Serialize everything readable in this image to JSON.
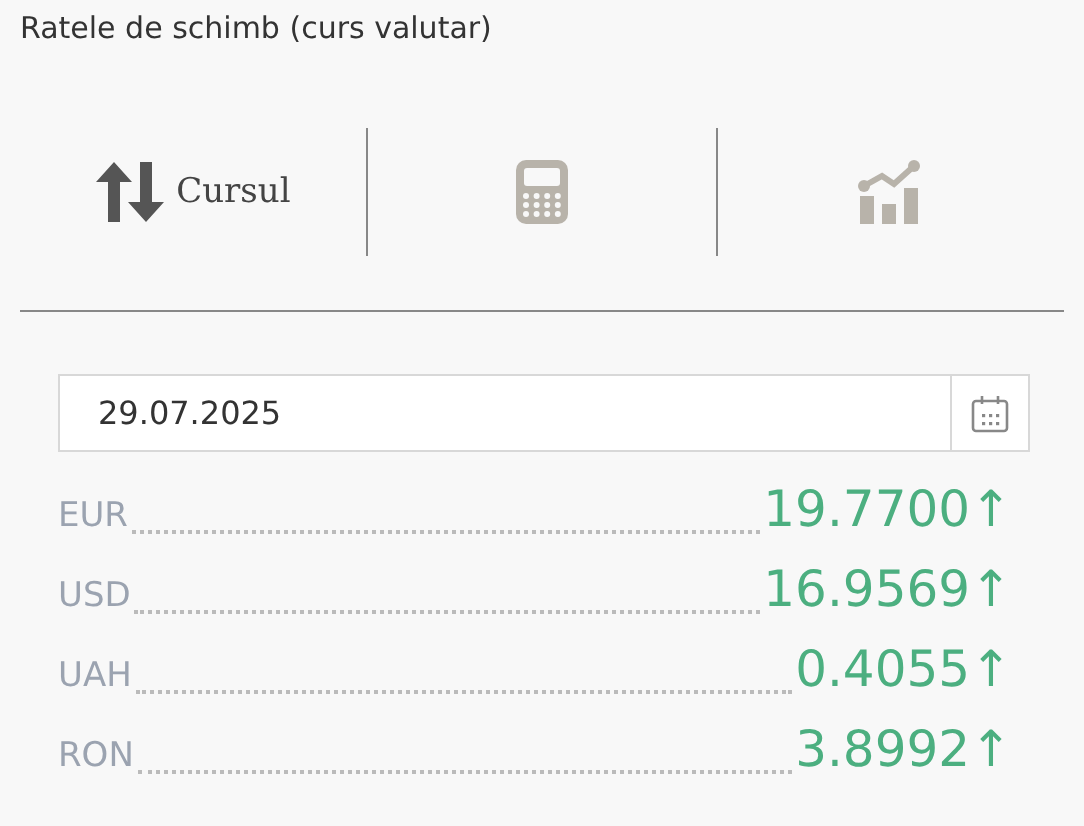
{
  "title": "Ratele de schimb (curs valutar)",
  "tabs": [
    {
      "kind": "exchange",
      "label": "Cursul",
      "selected": true
    },
    {
      "kind": "calculator",
      "selected": false
    },
    {
      "kind": "chart",
      "selected": false
    }
  ],
  "date_field": {
    "value": "29.07.2025"
  },
  "rates": [
    {
      "currency": "EUR",
      "value": "19.7700",
      "arrow": "↑"
    },
    {
      "currency": "USD",
      "value": "16.9569",
      "arrow": "↑"
    },
    {
      "currency": "UAH",
      "value": "0.4055",
      "arrow": "↑"
    },
    {
      "currency": "RON",
      "value": "3.8992",
      "arrow": "↑"
    }
  ]
}
